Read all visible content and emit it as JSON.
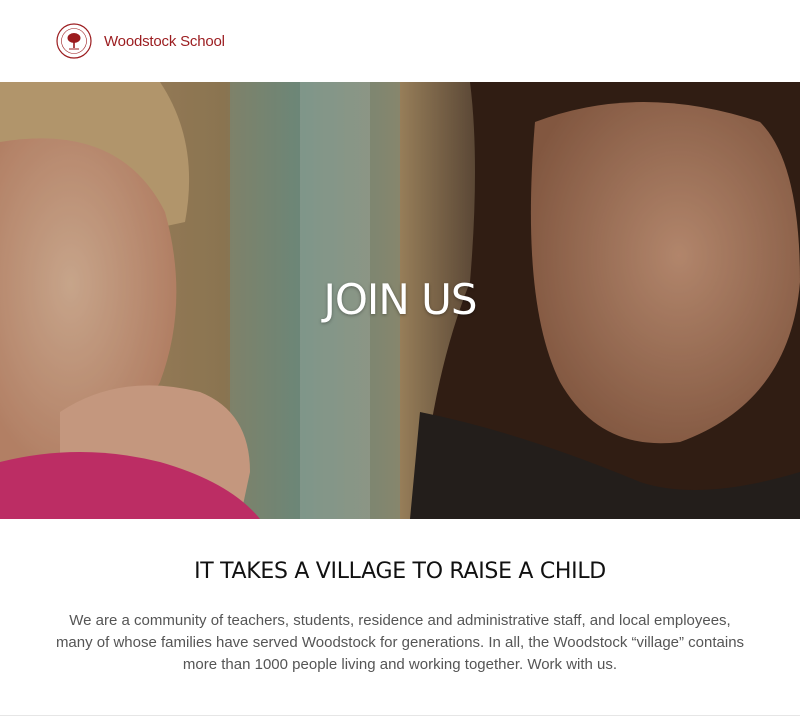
{
  "header": {
    "brand": "Woodstock School",
    "seal_icon": "woodstock-tree-seal"
  },
  "hero": {
    "title": "JOIN US"
  },
  "section": {
    "title": "IT TAKES A VILLAGE TO RAISE A CHILD",
    "body": "We are a community of teachers, students, residence and administrative staff, and local employees, many of whose families have served Woodstock for generations. In all, the Woodstock “village” contains more than 1000 people living and working together. Work with us."
  },
  "colors": {
    "brand_red": "#9b1c1f",
    "heading": "#111111",
    "body_text": "#555555"
  }
}
